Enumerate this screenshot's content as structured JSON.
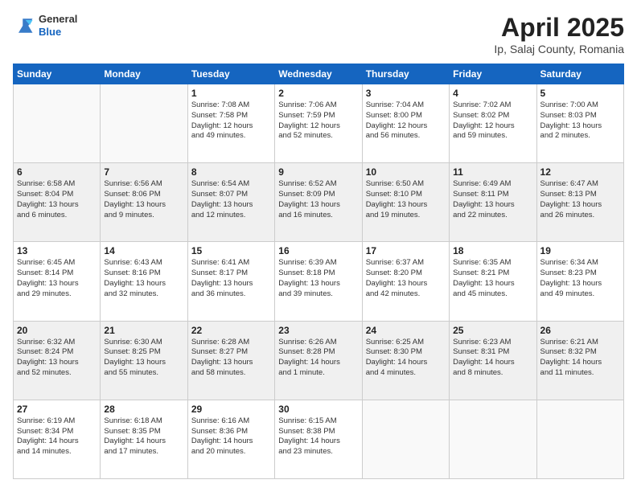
{
  "header": {
    "logo_general": "General",
    "logo_blue": "Blue",
    "month_title": "April 2025",
    "location": "Ip, Salaj County, Romania"
  },
  "weekdays": [
    "Sunday",
    "Monday",
    "Tuesday",
    "Wednesday",
    "Thursday",
    "Friday",
    "Saturday"
  ],
  "weeks": [
    [
      {
        "day": "",
        "info": ""
      },
      {
        "day": "",
        "info": ""
      },
      {
        "day": "1",
        "info": "Sunrise: 7:08 AM\nSunset: 7:58 PM\nDaylight: 12 hours\nand 49 minutes."
      },
      {
        "day": "2",
        "info": "Sunrise: 7:06 AM\nSunset: 7:59 PM\nDaylight: 12 hours\nand 52 minutes."
      },
      {
        "day": "3",
        "info": "Sunrise: 7:04 AM\nSunset: 8:00 PM\nDaylight: 12 hours\nand 56 minutes."
      },
      {
        "day": "4",
        "info": "Sunrise: 7:02 AM\nSunset: 8:02 PM\nDaylight: 12 hours\nand 59 minutes."
      },
      {
        "day": "5",
        "info": "Sunrise: 7:00 AM\nSunset: 8:03 PM\nDaylight: 13 hours\nand 2 minutes."
      }
    ],
    [
      {
        "day": "6",
        "info": "Sunrise: 6:58 AM\nSunset: 8:04 PM\nDaylight: 13 hours\nand 6 minutes."
      },
      {
        "day": "7",
        "info": "Sunrise: 6:56 AM\nSunset: 8:06 PM\nDaylight: 13 hours\nand 9 minutes."
      },
      {
        "day": "8",
        "info": "Sunrise: 6:54 AM\nSunset: 8:07 PM\nDaylight: 13 hours\nand 12 minutes."
      },
      {
        "day": "9",
        "info": "Sunrise: 6:52 AM\nSunset: 8:09 PM\nDaylight: 13 hours\nand 16 minutes."
      },
      {
        "day": "10",
        "info": "Sunrise: 6:50 AM\nSunset: 8:10 PM\nDaylight: 13 hours\nand 19 minutes."
      },
      {
        "day": "11",
        "info": "Sunrise: 6:49 AM\nSunset: 8:11 PM\nDaylight: 13 hours\nand 22 minutes."
      },
      {
        "day": "12",
        "info": "Sunrise: 6:47 AM\nSunset: 8:13 PM\nDaylight: 13 hours\nand 26 minutes."
      }
    ],
    [
      {
        "day": "13",
        "info": "Sunrise: 6:45 AM\nSunset: 8:14 PM\nDaylight: 13 hours\nand 29 minutes."
      },
      {
        "day": "14",
        "info": "Sunrise: 6:43 AM\nSunset: 8:16 PM\nDaylight: 13 hours\nand 32 minutes."
      },
      {
        "day": "15",
        "info": "Sunrise: 6:41 AM\nSunset: 8:17 PM\nDaylight: 13 hours\nand 36 minutes."
      },
      {
        "day": "16",
        "info": "Sunrise: 6:39 AM\nSunset: 8:18 PM\nDaylight: 13 hours\nand 39 minutes."
      },
      {
        "day": "17",
        "info": "Sunrise: 6:37 AM\nSunset: 8:20 PM\nDaylight: 13 hours\nand 42 minutes."
      },
      {
        "day": "18",
        "info": "Sunrise: 6:35 AM\nSunset: 8:21 PM\nDaylight: 13 hours\nand 45 minutes."
      },
      {
        "day": "19",
        "info": "Sunrise: 6:34 AM\nSunset: 8:23 PM\nDaylight: 13 hours\nand 49 minutes."
      }
    ],
    [
      {
        "day": "20",
        "info": "Sunrise: 6:32 AM\nSunset: 8:24 PM\nDaylight: 13 hours\nand 52 minutes."
      },
      {
        "day": "21",
        "info": "Sunrise: 6:30 AM\nSunset: 8:25 PM\nDaylight: 13 hours\nand 55 minutes."
      },
      {
        "day": "22",
        "info": "Sunrise: 6:28 AM\nSunset: 8:27 PM\nDaylight: 13 hours\nand 58 minutes."
      },
      {
        "day": "23",
        "info": "Sunrise: 6:26 AM\nSunset: 8:28 PM\nDaylight: 14 hours\nand 1 minute."
      },
      {
        "day": "24",
        "info": "Sunrise: 6:25 AM\nSunset: 8:30 PM\nDaylight: 14 hours\nand 4 minutes."
      },
      {
        "day": "25",
        "info": "Sunrise: 6:23 AM\nSunset: 8:31 PM\nDaylight: 14 hours\nand 8 minutes."
      },
      {
        "day": "26",
        "info": "Sunrise: 6:21 AM\nSunset: 8:32 PM\nDaylight: 14 hours\nand 11 minutes."
      }
    ],
    [
      {
        "day": "27",
        "info": "Sunrise: 6:19 AM\nSunset: 8:34 PM\nDaylight: 14 hours\nand 14 minutes."
      },
      {
        "day": "28",
        "info": "Sunrise: 6:18 AM\nSunset: 8:35 PM\nDaylight: 14 hours\nand 17 minutes."
      },
      {
        "day": "29",
        "info": "Sunrise: 6:16 AM\nSunset: 8:36 PM\nDaylight: 14 hours\nand 20 minutes."
      },
      {
        "day": "30",
        "info": "Sunrise: 6:15 AM\nSunset: 8:38 PM\nDaylight: 14 hours\nand 23 minutes."
      },
      {
        "day": "",
        "info": ""
      },
      {
        "day": "",
        "info": ""
      },
      {
        "day": "",
        "info": ""
      }
    ]
  ]
}
